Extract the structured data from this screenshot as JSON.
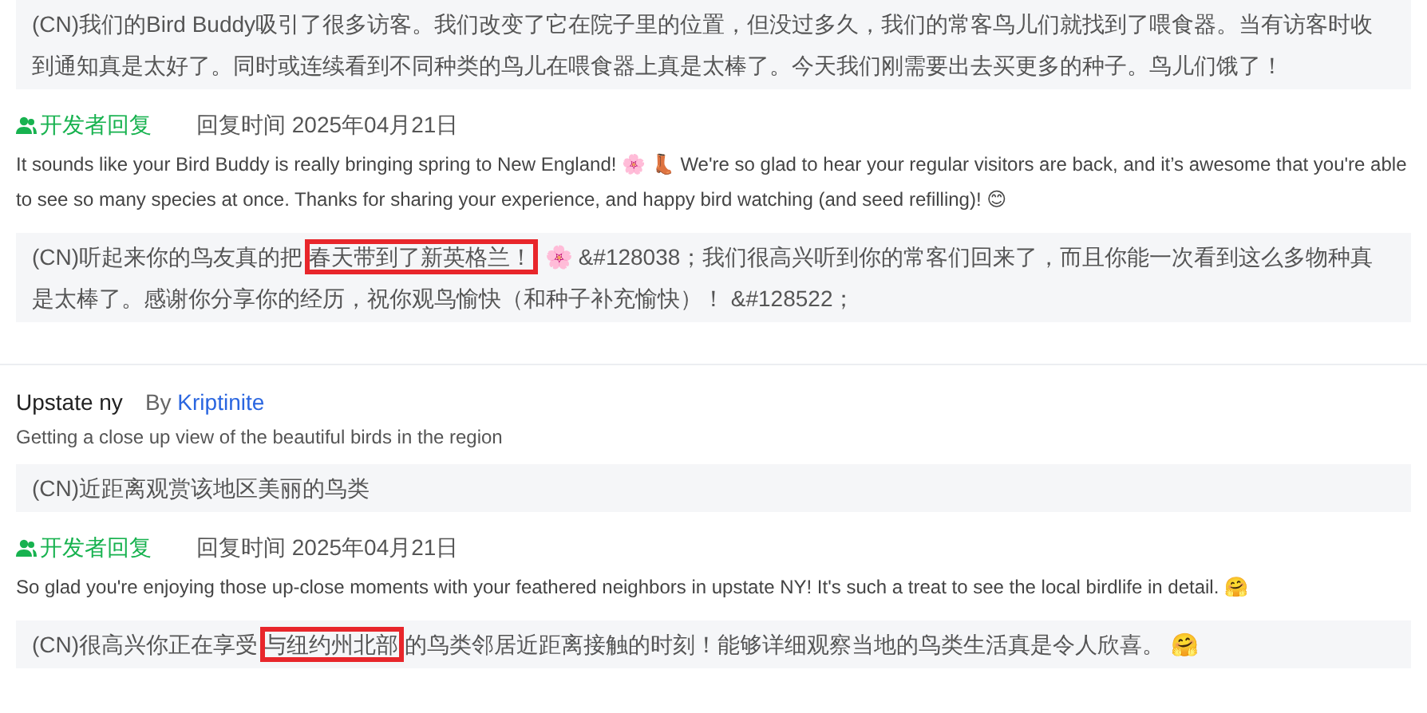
{
  "sections": [
    {
      "translation": [
        {
          "text": "(CN)我们的Bird Buddy吸引了很多访客。我们改变了它在院子里的位置，但没过多久，我们的常客鸟儿们就找到了喂食器。当有访客时收到通知真是太好了。同时或连续看到不同种类的鸟儿在喂食器上真是太棒了。今天我们刚需要出去买更多的种子。鸟儿们饿了！",
          "highlighted": false
        }
      ],
      "reply": {
        "badge": "开发者回复",
        "time": "回复时间 2025年04月21日",
        "text": "It sounds like your Bird Buddy is really bringing spring to New England! 🌸 👢 We're so glad to hear your regular visitors are back, and it’s awesome that you're able to see so many species at once. Thanks for sharing your experience, and happy bird watching (and seed refilling)! 😊",
        "translation": [
          {
            "text": "(CN)听起来你的鸟友真的把",
            "highlighted": false
          },
          {
            "text": "春天带到了新英格兰！",
            "highlighted": true
          },
          {
            "text": " 🌸 &#128038；我们很高兴听到你的常客们回来了，而且你能一次看到这么多物种真是太棒了。感谢你分享你的经历，祝你观鸟愉快（和种子补充愉快）！ &#128522；",
            "highlighted": false
          }
        ]
      }
    },
    {
      "title": "Upstate ny",
      "by": "By",
      "author": "Kriptinite",
      "body": "Getting a close up view of the beautiful birds in the region",
      "translation": [
        {
          "text": "(CN)近距离观赏该地区美丽的鸟类",
          "highlighted": false
        }
      ],
      "reply": {
        "badge": "开发者回复",
        "time": "回复时间 2025年04月21日",
        "text": "So glad you're enjoying those up-close moments with your feathered neighbors in upstate NY! It's such a treat to see the local birdlife in detail. 🤗",
        "translation": [
          {
            "text": "(CN)很高兴你正在享受",
            "highlighted": false
          },
          {
            "text": "与纽约州北部",
            "highlighted": true
          },
          {
            "text": "的鸟类邻居近距离接触的时刻！能够详细观察当地的鸟类生活真是令人欣喜。 🤗",
            "highlighted": false
          }
        ]
      }
    }
  ]
}
